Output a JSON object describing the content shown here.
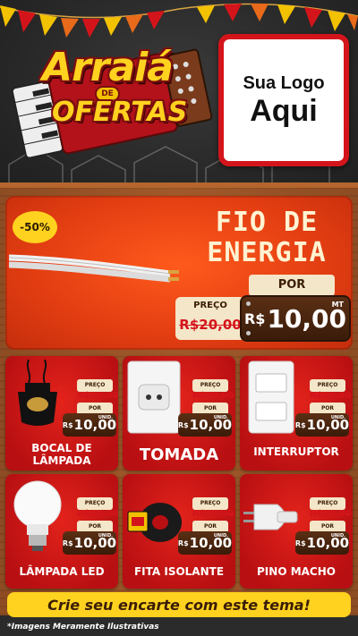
{
  "header": {
    "title_main": "Arraiá",
    "title_connector": "DE",
    "title_sub": "OFERTAS",
    "logo_line1": "Sua Logo",
    "logo_line2": "Aqui"
  },
  "featured": {
    "discount": "-50%",
    "title_line1": "FIO DE",
    "title_line2": "ENERGIA",
    "por_label": "POR",
    "preco_label": "PREÇO",
    "old_price": "R$20,00",
    "currency": "R$",
    "price": "10,00",
    "unit": "MT"
  },
  "price_labels": {
    "preco": "PREÇO",
    "old": "R$20,00",
    "por": "POR",
    "currency": "R$",
    "price": "10,00",
    "unit": "UNID."
  },
  "products": [
    {
      "name_line1": "BOCAL DE",
      "name_line2": "LÂMPADA"
    },
    {
      "name_line1": "TOMADA",
      "name_line2": ""
    },
    {
      "name_line1": "INTERRUPTOR",
      "name_line2": ""
    },
    {
      "name_line1": "LÂMPADA LED",
      "name_line2": ""
    },
    {
      "name_line1": "FITA ISOLANTE",
      "name_line2": ""
    },
    {
      "name_line1": "PINO MACHO",
      "name_line2": ""
    }
  ],
  "banner": "Crie seu encarte com este tema!",
  "disclaimer": "*Imagens Meramente Ilustrativas",
  "colors": {
    "red": "#d4141b",
    "yellow": "#ffd21f",
    "orange": "#e23d12",
    "wood": "#8a4a22",
    "cream": "#f4e6c8"
  }
}
